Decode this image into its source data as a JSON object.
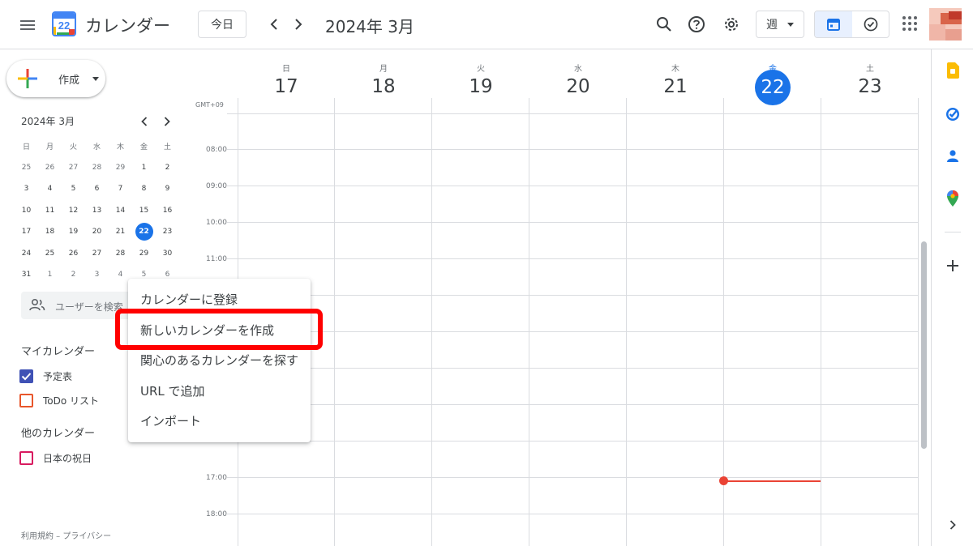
{
  "header": {
    "logo_day": "22",
    "app_title": "カレンダー",
    "today_label": "今日",
    "prev_icon": "chevron-left-icon",
    "next_icon": "chevron-right-icon",
    "month_title": "2024年 3月",
    "view_label": "週",
    "icons": [
      "menu-icon",
      "search-icon",
      "help-icon",
      "gear-icon",
      "calendar-view-icon",
      "tasks-check-icon",
      "apps-grid-icon"
    ]
  },
  "sidebar": {
    "create_label": "作成",
    "mini_calendar": {
      "title": "2024年 3月",
      "days_of_week": [
        "日",
        "月",
        "火",
        "水",
        "木",
        "金",
        "土"
      ],
      "weeks": [
        [
          "25",
          "26",
          "27",
          "28",
          "29",
          "1",
          "2"
        ],
        [
          "3",
          "4",
          "5",
          "6",
          "7",
          "8",
          "9"
        ],
        [
          "10",
          "11",
          "12",
          "13",
          "14",
          "15",
          "16"
        ],
        [
          "17",
          "18",
          "19",
          "20",
          "21",
          "22",
          "23"
        ],
        [
          "24",
          "25",
          "26",
          "27",
          "28",
          "29",
          "30"
        ],
        [
          "31",
          "1",
          "2",
          "3",
          "4",
          "5",
          "6"
        ]
      ],
      "today": "22"
    },
    "search_users_placeholder": "ユーザーを検索",
    "my_calendars_title": "マイカレンダー",
    "my_calendars": [
      {
        "label": "予定表",
        "color": "#3f51b5",
        "checked": true
      },
      {
        "label": "ToDo リスト",
        "color": "#e8562b",
        "checked": false
      }
    ],
    "other_calendars_title": "他のカレンダー",
    "other_calendars": [
      {
        "label": "日本の祝日",
        "color": "#d81b60",
        "checked": false
      }
    ],
    "footer": "利用規約 – プライバシー"
  },
  "main": {
    "timezone": "GMT+09",
    "days": [
      {
        "dow": "日",
        "num": "17"
      },
      {
        "dow": "月",
        "num": "18"
      },
      {
        "dow": "火",
        "num": "19"
      },
      {
        "dow": "水",
        "num": "20"
      },
      {
        "dow": "木",
        "num": "21"
      },
      {
        "dow": "金",
        "num": "22",
        "today": true
      },
      {
        "dow": "土",
        "num": "23"
      }
    ],
    "times": [
      "08:00",
      "09:00",
      "10:00",
      "11:00",
      "17:00",
      "18:00"
    ]
  },
  "side_panel": {
    "icons": [
      "keep-icon",
      "tasks-icon",
      "contacts-icon",
      "maps-icon",
      "add-icon",
      "expand-icon"
    ]
  },
  "context_menu": {
    "items": [
      "カレンダーに登録",
      "新しいカレンダーを作成",
      "関心のあるカレンダーを探す",
      "URL で追加",
      "インポート"
    ],
    "highlighted_index": 1
  },
  "colors": {
    "accent": "#1a73e8",
    "now_line": "#ea4335",
    "highlight_box": "#ff0000"
  }
}
